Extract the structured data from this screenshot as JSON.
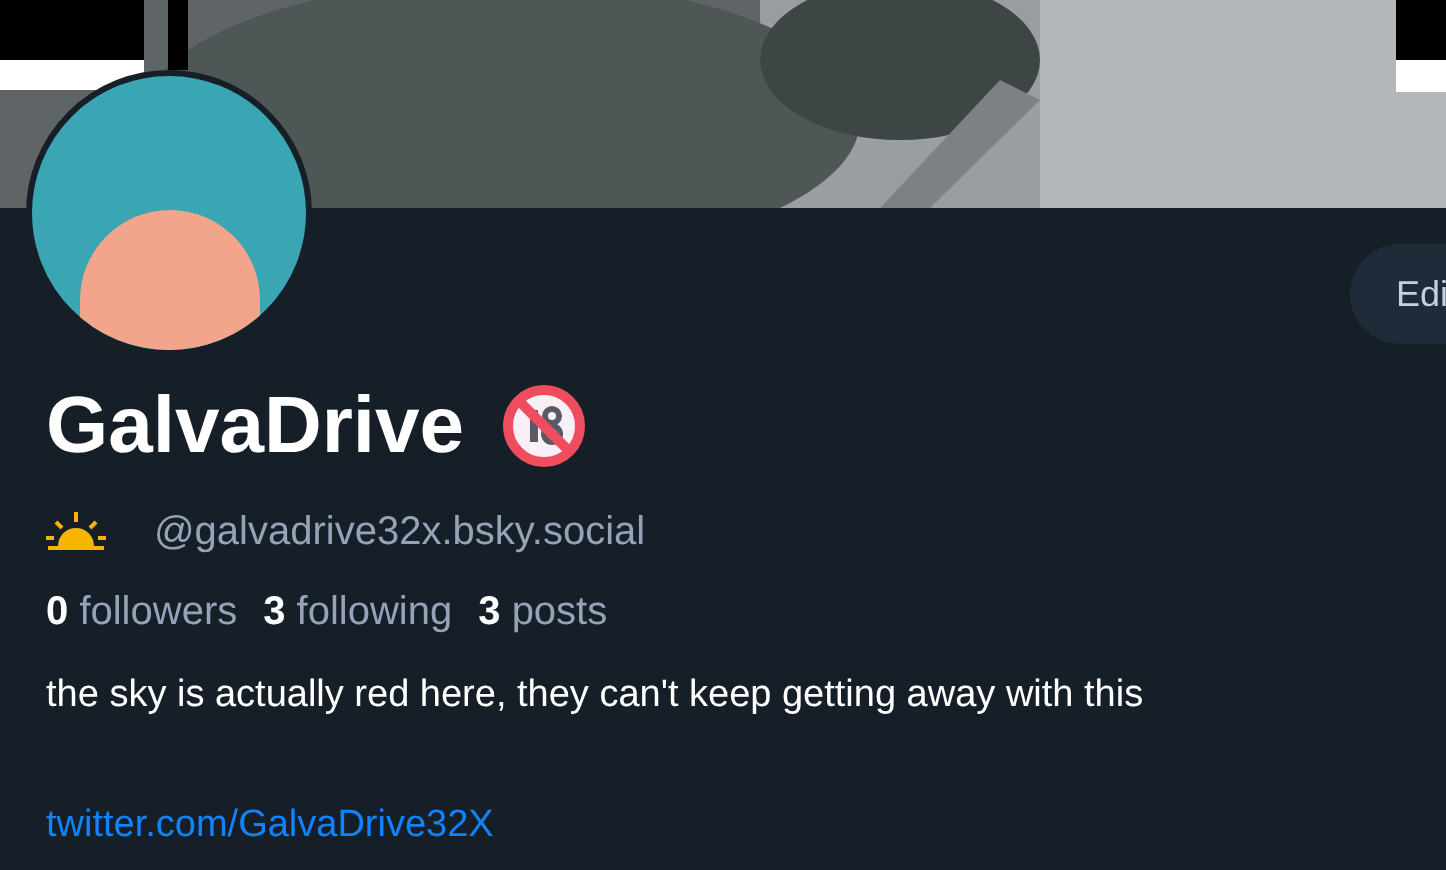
{
  "edit_button": {
    "label": "Edi"
  },
  "profile": {
    "display_name": "GalvaDrive",
    "handle": "@galvadrive32x.bsky.social",
    "stats": [
      {
        "count": "0",
        "label": "followers"
      },
      {
        "count": "3",
        "label": "following"
      },
      {
        "count": "3",
        "label": "posts"
      }
    ],
    "bio": "the sky is actually red here, they can't keep getting away with this",
    "link": "twitter.com/GalvaDrive32X"
  }
}
